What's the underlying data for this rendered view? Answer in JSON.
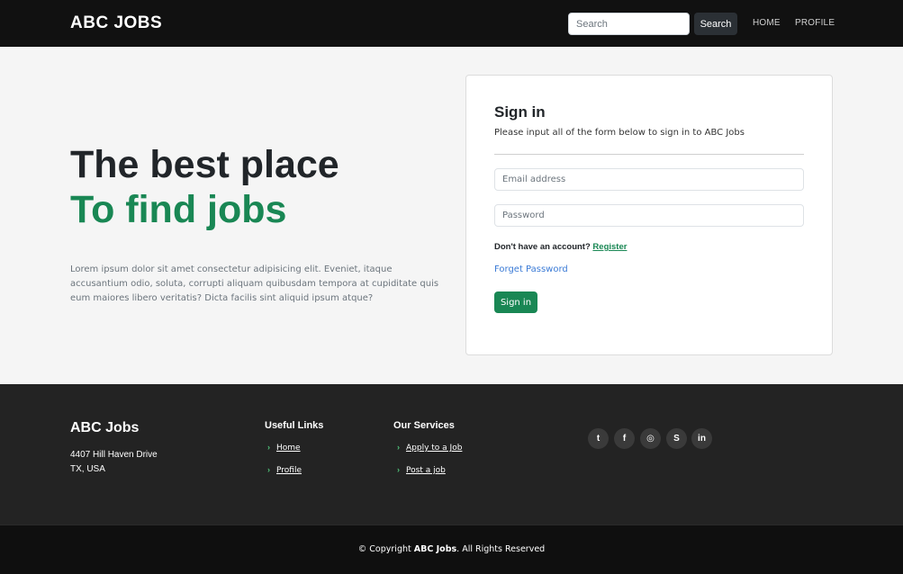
{
  "nav": {
    "brand": "ABC JOBS",
    "search_placeholder": "Search",
    "search_button": "Search",
    "home": "HOME",
    "profile": "PROFILE"
  },
  "hero": {
    "title_line1": "The best place",
    "title_line2": "To find jobs",
    "description": "Lorem ipsum dolor sit amet consectetur adipisicing elit. Eveniet, itaque accusantium odio, soluta, corrupti aliquam quibusdam tempora at cupiditate quis eum maiores libero veritatis? Dicta facilis sint aliquid ipsum atque?"
  },
  "signin": {
    "title": "Sign in",
    "subtitle": "Please input all of the form below to sign in to ABC Jobs",
    "email_placeholder": "Email address",
    "password_placeholder": "Password",
    "no_account_text": "Don't have an account?",
    "register_link": "Register",
    "forget_password": "Forget Password",
    "submit_button": "Sign in"
  },
  "footer": {
    "brand": "ABC Jobs",
    "address_line1": "4407 Hill Haven Drive",
    "address_line2": "TX, USA",
    "useful_links_title": "Useful Links",
    "useful_links": [
      "Home",
      "Profile"
    ],
    "services_title": "Our Services",
    "services": [
      "Apply to a Job",
      "Post a job"
    ],
    "social": [
      {
        "name": "twitter-icon",
        "glyph": "t"
      },
      {
        "name": "facebook-icon",
        "glyph": "f"
      },
      {
        "name": "instagram-icon",
        "glyph": "◎"
      },
      {
        "name": "skype-icon",
        "glyph": "S"
      },
      {
        "name": "linkedin-icon",
        "glyph": "in"
      }
    ],
    "copyright_prefix": "© Copyright",
    "copyright_brand": "ABC Jobs",
    "copyright_suffix": ". All Rights Reserved"
  },
  "colors": {
    "accent": "#198754",
    "navbar_bg": "#111111",
    "footer_bg": "#232323"
  }
}
